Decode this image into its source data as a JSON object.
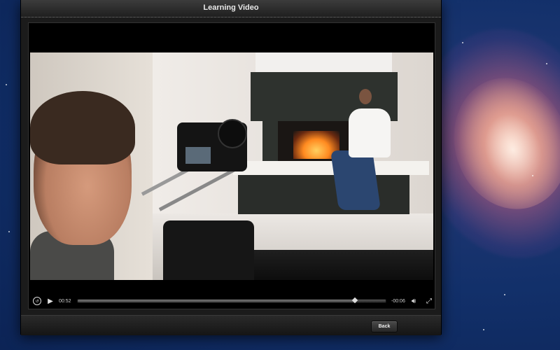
{
  "window": {
    "title": "Learning Video"
  },
  "player": {
    "elapsed": "00:52",
    "remaining": "-00:06",
    "progress": 0.9,
    "icons": {
      "replay": "replay-icon",
      "play": "play-icon",
      "volume": "volume-icon",
      "fullscreen": "fullscreen-icon"
    }
  },
  "footer": {
    "back_label": "Back"
  }
}
